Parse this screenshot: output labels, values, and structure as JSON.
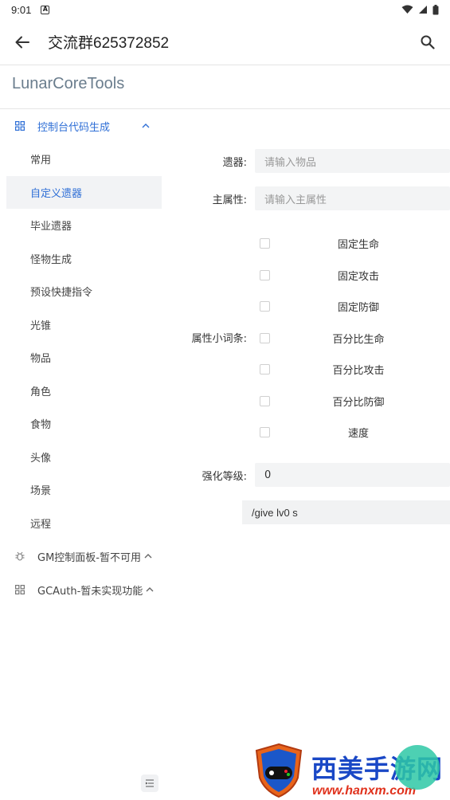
{
  "status_bar": {
    "time": "9:01",
    "badge": "A"
  },
  "app_bar": {
    "title": "交流群625372852"
  },
  "tools_title": "LunarCoreTools",
  "sidebar": {
    "group1": {
      "label": "控制台代码生成",
      "items": [
        "常用",
        "自定义遗器",
        "毕业遗器",
        "怪物生成",
        "预设快捷指令",
        "光锥",
        "物品",
        "角色",
        "食物",
        "头像",
        "场景",
        "远程"
      ],
      "selected_index": 1
    },
    "group2": {
      "label": "GM控制面板-暂不可用"
    },
    "group3": {
      "label": "GCAuth-暂未实现功能"
    }
  },
  "form": {
    "relic_label": "遗器:",
    "relic_placeholder": "请输入物品",
    "main_attr_label": "主属性:",
    "main_attr_placeholder": "请输入主属性",
    "substats_label": "属性小词条:",
    "substats": [
      "固定生命",
      "固定攻击",
      "固定防御",
      "百分比生命",
      "百分比攻击",
      "百分比防御",
      "速度"
    ],
    "level_label": "强化等级:",
    "level_value": "0",
    "command": "/give  lv0 s"
  },
  "watermark": {
    "title": "西美手游网",
    "url": "www.hanxm.com"
  },
  "colors": {
    "accent": "#2f6fd6",
    "input_bg": "#f3f4f5",
    "selected_bg": "#f2f3f5"
  }
}
